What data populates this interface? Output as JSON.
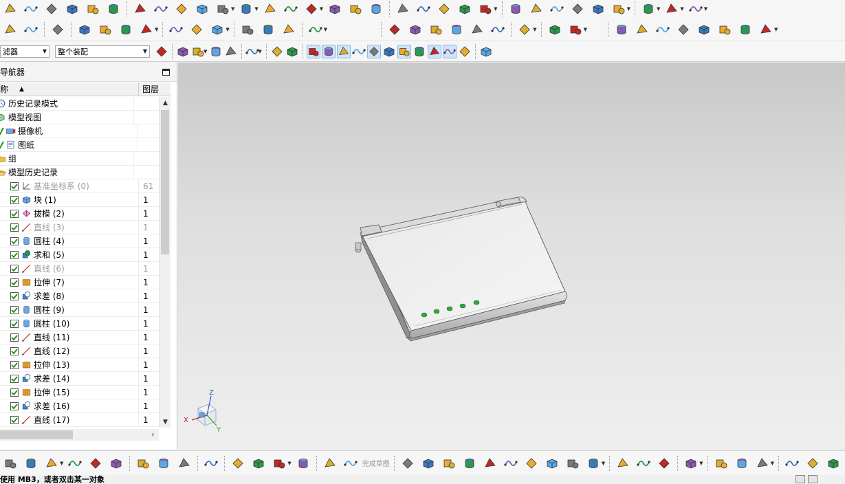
{
  "toolbar3": {
    "filter_combo": "滤器",
    "assembly_combo": "整个装配"
  },
  "toolbar4": {
    "finish_sketch": "完成草图"
  },
  "navigator": {
    "title": "导航器",
    "col_name": "称",
    "col_layer": "图层",
    "rows": [
      {
        "label": "历史记录模式",
        "layer": "",
        "indent": 0,
        "icon": "clock-icon",
        "check": false,
        "green": false,
        "dim": false
      },
      {
        "label": "模型视图",
        "layer": "",
        "indent": 0,
        "icon": "model-view-icon",
        "check": false,
        "green": false,
        "dim": false
      },
      {
        "label": "摄像机",
        "layer": "",
        "indent": 0,
        "icon": "camera-icon",
        "check": false,
        "green": true,
        "dim": false
      },
      {
        "label": "图纸",
        "layer": "",
        "indent": 0,
        "icon": "drawing-sheet-icon",
        "check": false,
        "green": true,
        "dim": false
      },
      {
        "label": "组",
        "layer": "",
        "indent": 0,
        "icon": "folder-icon",
        "check": false,
        "green": false,
        "dim": false
      },
      {
        "label": "模型历史记录",
        "layer": "",
        "indent": 0,
        "icon": "folder-open-icon",
        "check": false,
        "green": false,
        "dim": false
      },
      {
        "label": "基准坐标系 (0)",
        "layer": "61",
        "indent": 1,
        "icon": "datum-csys-icon",
        "check": true,
        "green": false,
        "dim": true
      },
      {
        "label": "块 (1)",
        "layer": "1",
        "indent": 1,
        "icon": "block-icon",
        "check": true,
        "green": false,
        "dim": false
      },
      {
        "label": "拔模 (2)",
        "layer": "1",
        "indent": 1,
        "icon": "draft-icon",
        "check": true,
        "green": false,
        "dim": false
      },
      {
        "label": "直线 (3)",
        "layer": "1",
        "indent": 1,
        "icon": "line-icon",
        "check": true,
        "green": false,
        "dim": true
      },
      {
        "label": "圆柱 (4)",
        "layer": "1",
        "indent": 1,
        "icon": "cylinder-icon",
        "check": true,
        "green": false,
        "dim": false
      },
      {
        "label": "求和 (5)",
        "layer": "1",
        "indent": 1,
        "icon": "unite-icon",
        "check": true,
        "green": false,
        "dim": false
      },
      {
        "label": "直线 (6)",
        "layer": "1",
        "indent": 1,
        "icon": "line-icon",
        "check": true,
        "green": false,
        "dim": true
      },
      {
        "label": "拉伸 (7)",
        "layer": "1",
        "indent": 1,
        "icon": "extrude-icon",
        "check": true,
        "green": false,
        "dim": false
      },
      {
        "label": "求差 (8)",
        "layer": "1",
        "indent": 1,
        "icon": "subtract-icon",
        "check": true,
        "green": false,
        "dim": false
      },
      {
        "label": "圆柱 (9)",
        "layer": "1",
        "indent": 1,
        "icon": "cylinder-icon",
        "check": true,
        "green": false,
        "dim": false
      },
      {
        "label": "圆柱 (10)",
        "layer": "1",
        "indent": 1,
        "icon": "cylinder-icon",
        "check": true,
        "green": false,
        "dim": false
      },
      {
        "label": "直线 (11)",
        "layer": "1",
        "indent": 1,
        "icon": "line-icon",
        "check": true,
        "green": false,
        "dim": false
      },
      {
        "label": "直线 (12)",
        "layer": "1",
        "indent": 1,
        "icon": "line-icon",
        "check": true,
        "green": false,
        "dim": false
      },
      {
        "label": "拉伸 (13)",
        "layer": "1",
        "indent": 1,
        "icon": "extrude-icon",
        "check": true,
        "green": false,
        "dim": false
      },
      {
        "label": "求差 (14)",
        "layer": "1",
        "indent": 1,
        "icon": "subtract-icon",
        "check": true,
        "green": false,
        "dim": false
      },
      {
        "label": "拉伸 (15)",
        "layer": "1",
        "indent": 1,
        "icon": "extrude-icon",
        "check": true,
        "green": false,
        "dim": false
      },
      {
        "label": "求差 (16)",
        "layer": "1",
        "indent": 1,
        "icon": "subtract-icon",
        "check": true,
        "green": false,
        "dim": false
      },
      {
        "label": "直线 (17)",
        "layer": "1",
        "indent": 1,
        "icon": "line-icon",
        "check": true,
        "green": false,
        "dim": false
      }
    ]
  },
  "triad": {
    "x": "X",
    "y": "Y",
    "z": "Z"
  },
  "status": {
    "text": "使用 MB3，或者双击某一对象"
  },
  "colors": {
    "led": "#2faa3a",
    "accent": "#3a78c4",
    "viewport_top": "#c8c8c8",
    "viewport_bottom": "#efefef"
  }
}
